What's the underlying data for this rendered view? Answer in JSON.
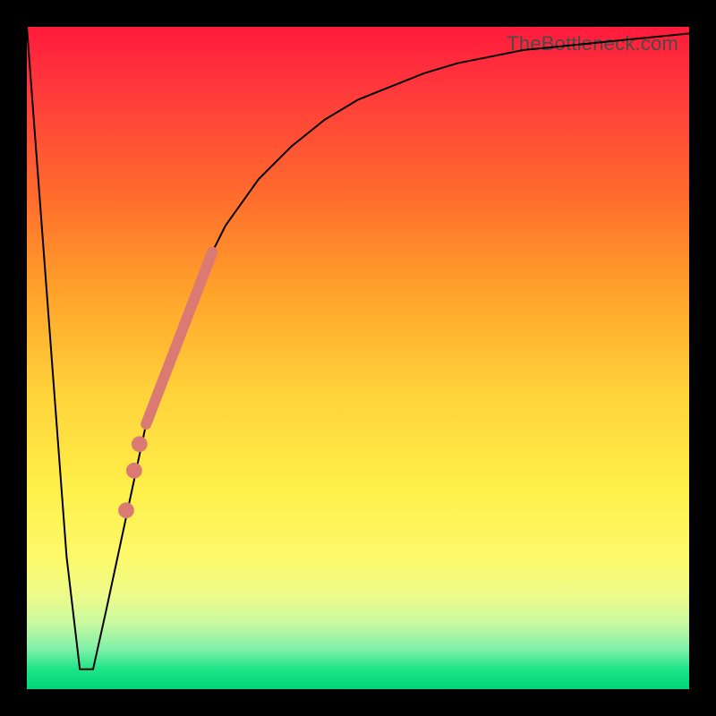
{
  "watermark": "TheBottleneck.com",
  "chart_data": {
    "type": "line",
    "title": "",
    "xlabel": "",
    "ylabel": "",
    "xlim": [
      0,
      100
    ],
    "ylim": [
      0,
      100
    ],
    "background_gradient": {
      "top_color": "#ff1a3c",
      "bottom_color": "#00d776",
      "meaning": "red=high, green=low"
    },
    "series": [
      {
        "name": "curve",
        "x": [
          0,
          3,
          6,
          8,
          10,
          12,
          15,
          18,
          22,
          26,
          30,
          35,
          40,
          45,
          50,
          55,
          60,
          65,
          70,
          75,
          80,
          85,
          90,
          95,
          100
        ],
        "y": [
          100,
          60,
          20,
          3,
          3,
          12,
          26,
          40,
          52,
          62,
          70,
          77,
          82,
          86,
          89,
          91,
          93,
          94.5,
          95.5,
          96.5,
          97,
          97.5,
          98,
          98.5,
          99
        ],
        "style": "black-line"
      },
      {
        "name": "highlight-segment",
        "x": [
          18,
          28
        ],
        "y": [
          40,
          66
        ],
        "style": "thick-salmon-line"
      },
      {
        "name": "highlight-dots",
        "points": [
          {
            "x": 17.0,
            "y": 37
          },
          {
            "x": 16.2,
            "y": 33
          },
          {
            "x": 15.0,
            "y": 27
          }
        ],
        "style": "salmon-dots"
      }
    ]
  }
}
